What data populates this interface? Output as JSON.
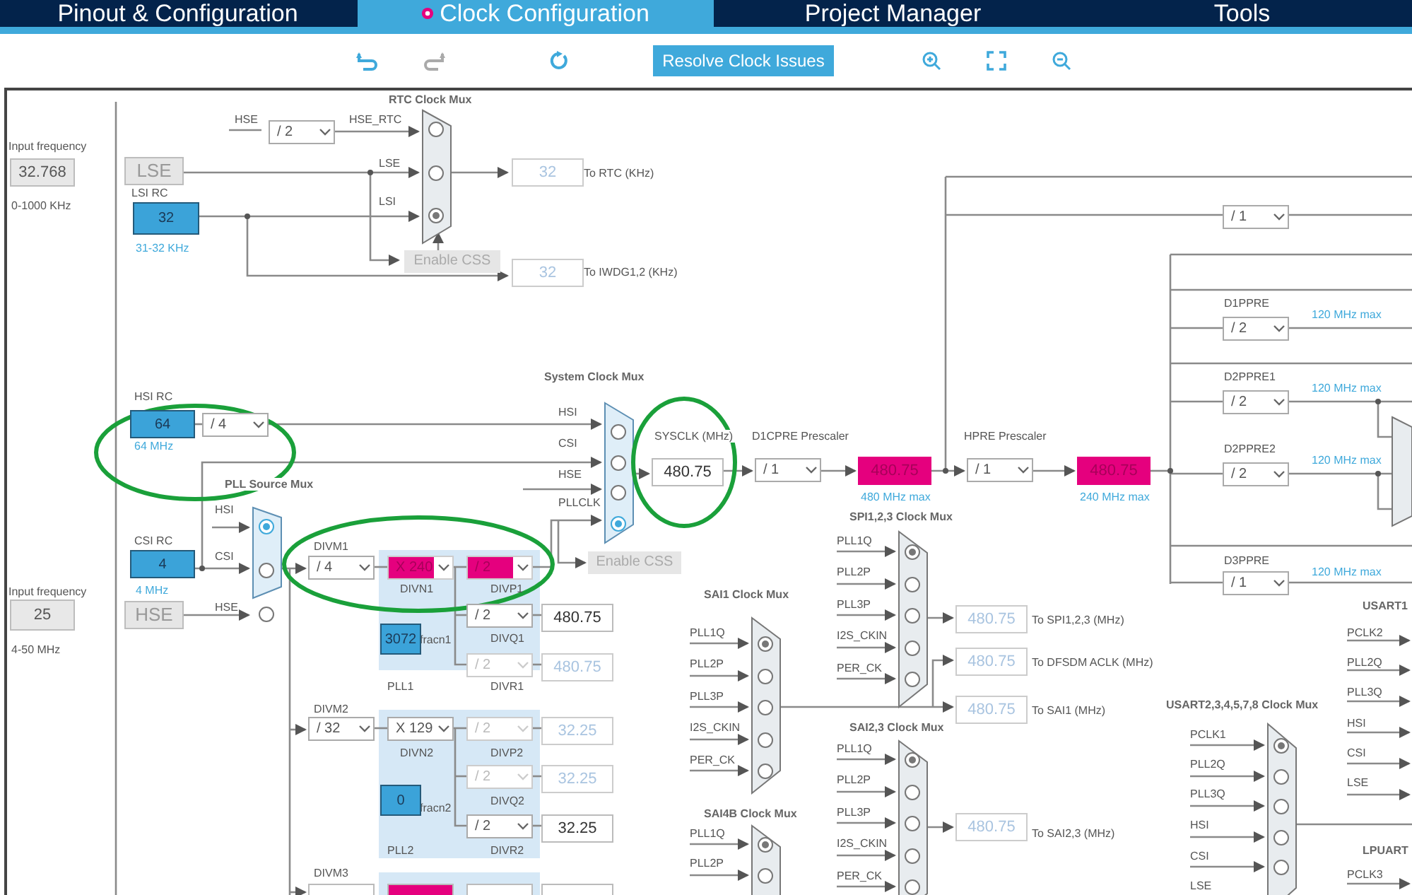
{
  "tabs": [
    {
      "label": "Pinout & Configuration",
      "selected": false,
      "warning": false
    },
    {
      "label": "Clock Configuration",
      "selected": true,
      "warning": true
    },
    {
      "label": "Project Manager",
      "selected": false,
      "warning": false
    },
    {
      "label": "Tools",
      "selected": false,
      "warning": false
    }
  ],
  "toolbar": {
    "resolve_button": "Resolve Clock Issues"
  },
  "diagram": {
    "labels": [
      {
        "text": "Input frequency",
        "kind": "text"
      },
      {
        "text": "0-1000 KHz",
        "kind": "text"
      },
      {
        "text": "LSI RC",
        "kind": "text"
      },
      {
        "text": "31-32 KHz",
        "kind": "note"
      },
      {
        "text": "HSE",
        "kind": "text"
      },
      {
        "text": "HSE_RTC",
        "kind": "text"
      },
      {
        "text": "RTC Clock Mux",
        "kind": "title"
      },
      {
        "text": "LSE",
        "kind": "text"
      },
      {
        "text": "LSI",
        "kind": "text"
      },
      {
        "text": "To RTC (KHz)",
        "kind": "text"
      },
      {
        "text": "To IWDG1,2 (KHz)",
        "kind": "text"
      },
      {
        "text": "System Clock Mux",
        "kind": "title"
      },
      {
        "text": "HSI RC",
        "kind": "text"
      },
      {
        "text": "64 MHz",
        "kind": "note"
      },
      {
        "text": "HSI",
        "kind": "text"
      },
      {
        "text": "CSI",
        "kind": "text"
      },
      {
        "text": "HSE",
        "kind": "text"
      },
      {
        "text": "PLLCLK",
        "kind": "text"
      },
      {
        "text": "SYSCLK (MHz)",
        "kind": "text"
      },
      {
        "text": "D1CPRE Prescaler",
        "kind": "text"
      },
      {
        "text": "480 MHz max",
        "kind": "note"
      },
      {
        "text": "HPRE Prescaler",
        "kind": "text"
      },
      {
        "text": "240 MHz max",
        "kind": "note"
      },
      {
        "text": "D1PPRE",
        "kind": "text"
      },
      {
        "text": "120 MHz max",
        "kind": "note"
      },
      {
        "text": "D2PPRE1",
        "kind": "text"
      },
      {
        "text": "120 MHz max",
        "kind": "note"
      },
      {
        "text": "D2PPRE2",
        "kind": "text"
      },
      {
        "text": "120 MHz max",
        "kind": "note"
      },
      {
        "text": "D3PPRE",
        "kind": "text"
      },
      {
        "text": "120 MHz max",
        "kind": "note"
      },
      {
        "text": "PLL Source Mux",
        "kind": "title"
      },
      {
        "text": "HSI",
        "kind": "text"
      },
      {
        "text": "CSI",
        "kind": "text"
      },
      {
        "text": "HSE",
        "kind": "text"
      },
      {
        "text": "CSI RC",
        "kind": "text"
      },
      {
        "text": "Input frequency",
        "kind": "text"
      },
      {
        "text": "4 MHz",
        "kind": "note"
      },
      {
        "text": "4-50 MHz",
        "kind": "text"
      },
      {
        "text": "DIVM1",
        "kind": "text"
      },
      {
        "text": "DIVN1",
        "kind": "text"
      },
      {
        "text": "DIVP1",
        "kind": "text"
      },
      {
        "text": "fracn1",
        "kind": "text"
      },
      {
        "text": "DIVQ1",
        "kind": "text"
      },
      {
        "text": "PLL1",
        "kind": "text"
      },
      {
        "text": "DIVR1",
        "kind": "text"
      },
      {
        "text": "DIVM2",
        "kind": "text"
      },
      {
        "text": "DIVN2",
        "kind": "text"
      },
      {
        "text": "DIVP2",
        "kind": "text"
      },
      {
        "text": "DIVQ2",
        "kind": "text"
      },
      {
        "text": "fracn2",
        "kind": "text"
      },
      {
        "text": "PLL2",
        "kind": "text"
      },
      {
        "text": "DIVR2",
        "kind": "text"
      },
      {
        "text": "DIVM3",
        "kind": "text"
      },
      {
        "text": "SPI1,2,3 Clock Mux",
        "kind": "title"
      },
      {
        "text": "PLL1Q",
        "kind": "text"
      },
      {
        "text": "PLL2P",
        "kind": "text"
      },
      {
        "text": "PLL3P",
        "kind": "text"
      },
      {
        "text": "I2S_CKIN",
        "kind": "text"
      },
      {
        "text": "PER_CK",
        "kind": "text"
      },
      {
        "text": "To SPI1,2,3 (MHz)",
        "kind": "text"
      },
      {
        "text": "To DFSDM ACLK (MHz)",
        "kind": "text"
      },
      {
        "text": "To SAI1 (MHz)",
        "kind": "text"
      },
      {
        "text": "SAI1 Clock Mux",
        "kind": "title"
      },
      {
        "text": "PLL1Q",
        "kind": "text"
      },
      {
        "text": "PLL2P",
        "kind": "text"
      },
      {
        "text": "PLL3P",
        "kind": "text"
      },
      {
        "text": "I2S_CKIN",
        "kind": "text"
      },
      {
        "text": "PER_CK",
        "kind": "text"
      },
      {
        "text": "SAI2,3 Clock Mux",
        "kind": "title"
      },
      {
        "text": "PLL1Q",
        "kind": "text"
      },
      {
        "text": "PLL2P",
        "kind": "text"
      },
      {
        "text": "PLL3P",
        "kind": "text"
      },
      {
        "text": "I2S_CKIN",
        "kind": "text"
      },
      {
        "text": "PER_CK",
        "kind": "text"
      },
      {
        "text": "To SAI2,3 (MHz)",
        "kind": "text"
      },
      {
        "text": "SAI4B Clock Mux",
        "kind": "title"
      },
      {
        "text": "PLL1Q",
        "kind": "text"
      },
      {
        "text": "PLL2P",
        "kind": "text"
      },
      {
        "text": "USART2,3,4,5,7,8 Clock Mux",
        "kind": "title"
      },
      {
        "text": "PCLK1",
        "kind": "text"
      },
      {
        "text": "PLL2Q",
        "kind": "text"
      },
      {
        "text": "PLL3Q",
        "kind": "text"
      },
      {
        "text": "HSI",
        "kind": "text"
      },
      {
        "text": "CSI",
        "kind": "text"
      },
      {
        "text": "LSE",
        "kind": "text"
      },
      {
        "text": "USART1",
        "kind": "title"
      },
      {
        "text": "PCLK2",
        "kind": "text"
      },
      {
        "text": "PLL2Q",
        "kind": "text"
      },
      {
        "text": "PLL3Q",
        "kind": "text"
      },
      {
        "text": "HSI",
        "kind": "text"
      },
      {
        "text": "CSI",
        "kind": "text"
      },
      {
        "text": "LSE",
        "kind": "text"
      },
      {
        "text": "LPUART",
        "kind": "title"
      },
      {
        "text": "PCLK3",
        "kind": "text"
      }
    ],
    "fields": [
      {
        "value": "32.768",
        "kind": "disabled"
      },
      {
        "value": "LSE",
        "kind": "source"
      },
      {
        "value": "32",
        "kind": "input"
      },
      {
        "value": "32",
        "kind": "output-disabled"
      },
      {
        "value": "32",
        "kind": "output-disabled"
      },
      {
        "value": "64",
        "kind": "input"
      },
      {
        "value": "480.75",
        "kind": "output"
      },
      {
        "value": "480.75",
        "kind": "error"
      },
      {
        "value": "480.75",
        "kind": "error"
      },
      {
        "value": "4",
        "kind": "input"
      },
      {
        "value": "25",
        "kind": "disabled"
      },
      {
        "value": "HSE",
        "kind": "source"
      },
      {
        "value": "3072",
        "kind": "input"
      },
      {
        "value": "480.75",
        "kind": "output"
      },
      {
        "value": "480.75",
        "kind": "output-disabled"
      },
      {
        "value": "32.25",
        "kind": "output-disabled"
      },
      {
        "value": "32.25",
        "kind": "output-disabled"
      },
      {
        "value": "0",
        "kind": "input"
      },
      {
        "value": "32.25",
        "kind": "output"
      },
      {
        "value": "480.75",
        "kind": "output-disabled"
      },
      {
        "value": "480.75",
        "kind": "output-disabled"
      },
      {
        "value": "480.75",
        "kind": "output-disabled"
      },
      {
        "value": "480.75",
        "kind": "output-disabled"
      }
    ],
    "dropdowns": [
      {
        "value": "/ 2",
        "kind": "normal"
      },
      {
        "value": "/ 4",
        "kind": "normal"
      },
      {
        "value": "/ 1",
        "kind": "normal"
      },
      {
        "value": "/ 1",
        "kind": "normal"
      },
      {
        "value": "/ 1",
        "kind": "normal"
      },
      {
        "value": "/ 2",
        "kind": "normal"
      },
      {
        "value": "/ 2",
        "kind": "normal"
      },
      {
        "value": "/ 2",
        "kind": "normal"
      },
      {
        "value": "/ 1",
        "kind": "normal"
      },
      {
        "value": "/ 4",
        "kind": "normal"
      },
      {
        "value": "X 240",
        "kind": "error"
      },
      {
        "value": "/ 2",
        "kind": "error"
      },
      {
        "value": "/ 2",
        "kind": "normal"
      },
      {
        "value": "/ 2",
        "kind": "disabled"
      },
      {
        "value": "/ 32",
        "kind": "normal"
      },
      {
        "value": "X 129",
        "kind": "normal"
      },
      {
        "value": "/ 2",
        "kind": "disabled"
      },
      {
        "value": "/ 2",
        "kind": "disabled"
      },
      {
        "value": "/ 2",
        "kind": "normal"
      }
    ],
    "muxes": [
      {
        "active": false,
        "options": [
          {
            "selected": false
          },
          {
            "selected": false
          },
          {
            "selected": true
          }
        ]
      },
      {
        "active": true,
        "options": [
          {
            "selected": false
          },
          {
            "selected": false
          },
          {
            "selected": false
          },
          {
            "selected": true
          }
        ]
      },
      {
        "active": true,
        "options": [
          {
            "selected": true
          },
          {
            "selected": false
          },
          {
            "selected": false
          }
        ]
      },
      {
        "active": false,
        "options": [
          {
            "selected": true
          },
          {
            "selected": false
          },
          {
            "selected": false
          },
          {
            "selected": false
          },
          {
            "selected": false
          }
        ]
      },
      {
        "active": false,
        "options": [
          {
            "selected": true
          },
          {
            "selected": false
          },
          {
            "selected": false
          },
          {
            "selected": false
          },
          {
            "selected": false
          }
        ]
      },
      {
        "active": false,
        "options": [
          {
            "selected": true
          },
          {
            "selected": false
          },
          {
            "selected": false
          },
          {
            "selected": false
          },
          {
            "selected": false
          }
        ]
      },
      {
        "active": false,
        "options": [
          {
            "selected": true
          },
          {
            "selected": false
          }
        ]
      },
      {
        "active": false,
        "options": [
          {
            "selected": true
          },
          {
            "selected": false
          },
          {
            "selected": false
          },
          {
            "selected": false
          },
          {
            "selected": false
          }
        ]
      }
    ],
    "buttons": [
      {
        "label": "Enable CSS",
        "disabled": true
      },
      {
        "label": "Enable CSS",
        "disabled": true
      }
    ]
  }
}
